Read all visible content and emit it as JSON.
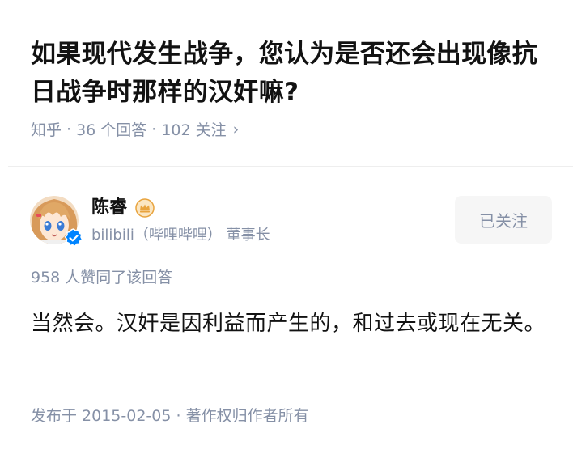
{
  "question": {
    "title": "如果现代发生战争，您认为是否还会出现像抗日战争时那样的汉奸嘛?",
    "source": "知乎",
    "answers_count": "36 个回答",
    "followers_count": "102 关注",
    "separator": "·",
    "chevron": "›"
  },
  "author": {
    "name": "陈睿",
    "description": "bilibili（哔哩哔哩） 董事长",
    "follow_label": "已关注",
    "avatar_icon": "anime-avatar",
    "badge_icon": "crown-badge-icon",
    "verified_icon": "verified-badge-icon"
  },
  "answer": {
    "vote_summary": "958 人赞同了该回答",
    "content": "当然会。汉奸是因利益而产生的，和过去或现在无关。",
    "footer": "发布于 2015-02-05 · 著作权归作者所有"
  },
  "colors": {
    "text_primary": "#121212",
    "text_secondary": "#8590a6",
    "button_bg": "#f6f6f6",
    "verified_blue": "#0084ff",
    "crown_gold": "#e8a33d"
  }
}
